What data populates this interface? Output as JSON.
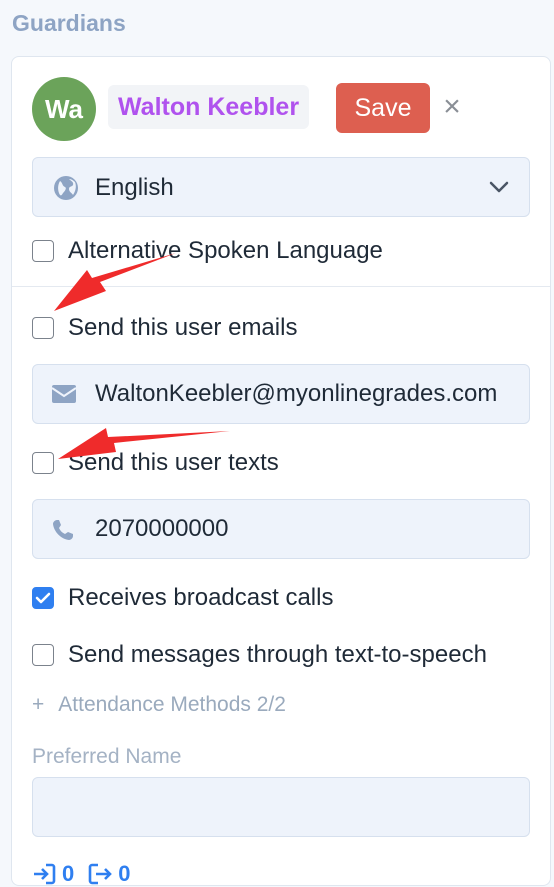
{
  "section": {
    "title": "Guardians"
  },
  "guardian": {
    "initials": "Wa",
    "name": "Walton Keebler",
    "save_label": "Save",
    "close_symbol": "×"
  },
  "language": {
    "selected": "English"
  },
  "options": {
    "alt_language": {
      "label": "Alternative Spoken Language",
      "checked": false
    },
    "send_emails": {
      "label": "Send this user emails",
      "checked": false
    },
    "email_value": "WaltonKeebler@myonlinegrades.com",
    "send_texts": {
      "label": "Send this user texts",
      "checked": false
    },
    "phone_value": "2070000000",
    "broadcast": {
      "label": "Receives broadcast calls",
      "checked": true
    },
    "tts": {
      "label": "Send messages through text-to-speech",
      "checked": false
    }
  },
  "attendance": {
    "plus": "+",
    "label": "Attendance Methods 2/2"
  },
  "preferred_name": {
    "label": "Preferred Name",
    "value": ""
  },
  "counts": {
    "first": "0",
    "second": "0"
  },
  "colors": {
    "accent": "#2f7ff0",
    "save": "#dd5f50",
    "name": "#b052ee",
    "avatar": "#6ba35a",
    "annotation_arrow": "#ef2b2b"
  },
  "icons": [
    "globe-icon",
    "chevron-down-icon",
    "envelope-icon",
    "phone-icon",
    "close-icon",
    "check-icon",
    "plus-icon",
    "login-icon",
    "logout-icon",
    "red-arrow-annotation"
  ]
}
